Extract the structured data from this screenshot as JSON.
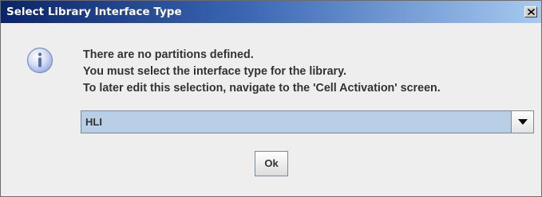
{
  "window": {
    "title": "Select Library Interface Type",
    "close_label": "×"
  },
  "message": {
    "lines": [
      "There are no partitions defined.",
      "You must select the interface type for the library.",
      "To later edit this selection, navigate to the 'Cell Activation' screen."
    ]
  },
  "interface_select": {
    "selected": "HLI"
  },
  "buttons": {
    "ok_label": "Ok"
  },
  "icons": {
    "info": "info-icon",
    "close": "close-icon",
    "dropdown": "chevron-down-icon"
  }
}
